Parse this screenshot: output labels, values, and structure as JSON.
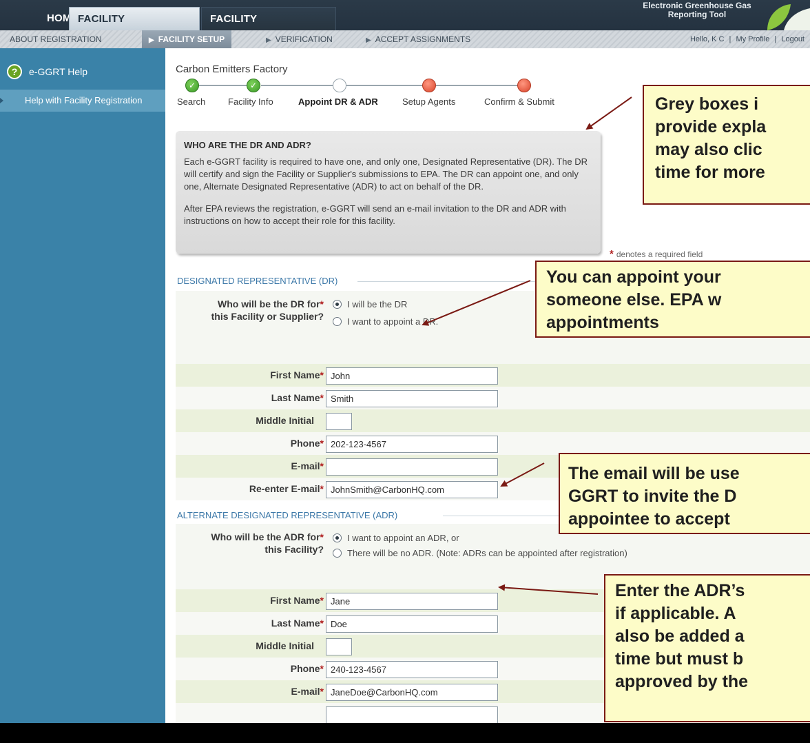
{
  "header": {
    "tabs": [
      {
        "label": "HOME"
      },
      {
        "label": "FACILITY REGISTRATION"
      },
      {
        "label": "FACILITY MANAGEMENT"
      }
    ],
    "brand_line1": "Electronic Greenhouse Gas",
    "brand_line2": "Reporting Tool",
    "subnav": [
      {
        "label": "ABOUT REGISTRATION"
      },
      {
        "label": "FACILITY SETUP"
      },
      {
        "label": "VERIFICATION"
      },
      {
        "label": "ACCEPT ASSIGNMENTS"
      }
    ],
    "user_greeting": "Hello, K C",
    "my_profile": "My Profile",
    "logout": "Logout",
    "separator": "|"
  },
  "sidebar": {
    "help_title": "e-GGRT Help",
    "help_link": "Help with Facility Registration"
  },
  "main": {
    "facility_name": "Carbon Emitters Factory",
    "steps": [
      {
        "label": "Search",
        "state": "done"
      },
      {
        "label": "Facility Info",
        "state": "done"
      },
      {
        "label": "Appoint DR & ADR",
        "state": "current"
      },
      {
        "label": "Setup Agents",
        "state": "todo"
      },
      {
        "label": "Confirm & Submit",
        "state": "todo"
      }
    ],
    "info_box": {
      "title": "WHO ARE THE DR AND ADR?",
      "para1": "Each e-GGRT facility is required to have one, and only one, Designated Representative (DR). The DR will certify and sign the Facility or Supplier's submissions to EPA. The DR can appoint one, and only one, Alternate Designated Representative (ADR) to act on behalf of the DR.",
      "para2": "After EPA reviews the registration, e-GGRT will send an e-mail invitation to the DR and ADR with instructions on how to accept their role for this facility."
    },
    "required_note": "denotes a required field",
    "required_star": "*",
    "dr": {
      "section_title": "DESIGNATED REPRESENTATIVE (DR)",
      "question_line1": "Who will be the DR for",
      "question_line2": "this Facility or Supplier?",
      "options": [
        {
          "label": "I will be the DR",
          "selected": true
        },
        {
          "label": "I want to appoint a DR.",
          "selected": false
        }
      ],
      "fields": [
        {
          "label": "First Name",
          "required": true,
          "value": "John"
        },
        {
          "label": "Last Name",
          "required": true,
          "value": "Smith"
        },
        {
          "label": "Middle Initial",
          "required": false,
          "value": ""
        },
        {
          "label": "Phone",
          "required": true,
          "value": "202-123-4567"
        },
        {
          "label": "E-mail",
          "required": true,
          "value": ""
        },
        {
          "label": "Re-enter E-mail",
          "required": true,
          "value": "JohnSmith@CarbonHQ.com"
        }
      ]
    },
    "adr": {
      "section_title": "ALTERNATE DESIGNATED REPRESENTATIVE (ADR)",
      "question_line1": "Who will be the ADR for",
      "question_line2": "this Facility?",
      "options": [
        {
          "label": "I want to appoint an ADR, or",
          "selected": true
        },
        {
          "label": "There will be no ADR. (Note: ADRs can be appointed after registration)",
          "selected": false
        }
      ],
      "fields": [
        {
          "label": "First Name",
          "required": true,
          "value": "Jane"
        },
        {
          "label": "Last Name",
          "required": true,
          "value": "Doe"
        },
        {
          "label": "Middle Initial",
          "required": false,
          "value": ""
        },
        {
          "label": "Phone",
          "required": true,
          "value": "240-123-4567"
        },
        {
          "label": "E-mail",
          "required": true,
          "value": "JaneDoe@CarbonHQ.com"
        }
      ]
    }
  },
  "callouts": {
    "grey_boxes": [
      "Grey boxes i",
      "provide expla",
      "may also clic",
      "time for more"
    ],
    "appoint": [
      "You can appoint your",
      "someone else.  EPA w",
      "appointments"
    ],
    "email": [
      "The email will be use",
      "GGRT to invite the D",
      "appointee to accept"
    ],
    "adr": [
      "Enter the ADR’s",
      "if applicable.  A",
      "also be added a",
      "time but must b",
      "approved by the"
    ]
  },
  "colors": {
    "sidebar": "#3a82a8",
    "callout_fill": "#fdfcc8",
    "callout_border": "#7a1a14",
    "required": "#b01e1e",
    "row_alt": "#ebf1dc"
  }
}
